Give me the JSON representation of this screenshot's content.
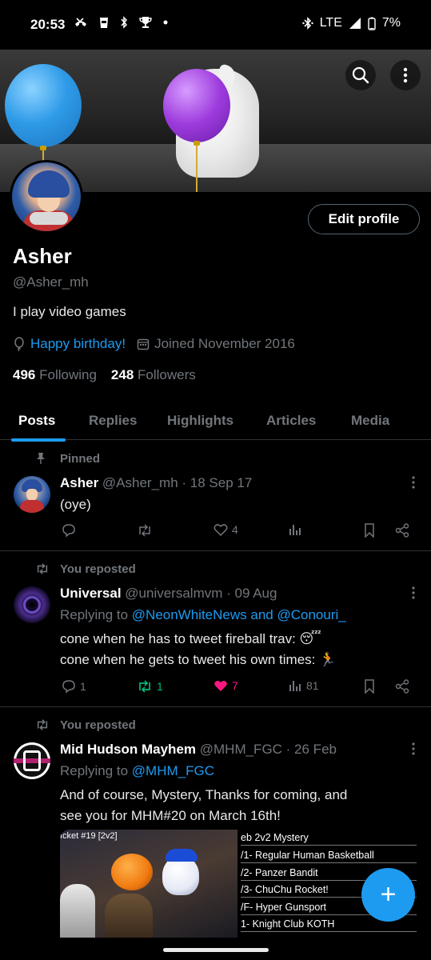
{
  "status_bar": {
    "time": "20:53",
    "left_icons": [
      "missed-call-icon",
      "cup-icon",
      "bluetooth-icon",
      "trophy-icon",
      "dot-icon"
    ],
    "network": "LTE",
    "battery": "7%"
  },
  "banner": {
    "search_icon": "search-icon",
    "more_icon": "more-vertical-icon"
  },
  "profile": {
    "edit_button": "Edit profile",
    "name": "Asher",
    "handle": "@Asher_mh",
    "bio": "I play video games",
    "birthday": "Happy birthday!",
    "joined": "Joined November 2016",
    "following_count": "496",
    "following_label": "Following",
    "followers_count": "248",
    "followers_label": "Followers"
  },
  "tabs": [
    {
      "label": "Posts",
      "active": true
    },
    {
      "label": "Replies",
      "active": false
    },
    {
      "label": "Highlights",
      "active": false
    },
    {
      "label": "Articles",
      "active": false
    },
    {
      "label": "Media",
      "active": false
    }
  ],
  "posts": [
    {
      "context": "Pinned",
      "name": "Asher",
      "handle_date": "@Asher_mh · 18 Sep 17",
      "text": "(oye)",
      "replies": "",
      "reposts": "",
      "likes": "4",
      "views": ""
    },
    {
      "context": "You reposted",
      "name": "Universal",
      "handle_date": "@universalmvm · 09 Aug",
      "reply_prefix": "Replying to ",
      "reply_targets": "@NeonWhiteNews and @Conouri_",
      "text_line1": "cone when he has to tweet fireball trav: 😴",
      "text_line2": "cone when he gets to tweet his own times: 🏃",
      "replies": "1",
      "reposts": "1",
      "likes": "7",
      "views": "81"
    },
    {
      "context": "You reposted",
      "name": "Mid Hudson Mayhem",
      "handle_date": "@MHM_FGC · 26 Feb",
      "reply_prefix": "Replying to ",
      "reply_targets": "@MHM_FGC",
      "text_line1": "And of course, Mystery, Thanks for coming, and",
      "text_line2": "see you for MHM#20 on March 16th!",
      "media_left_title": "ıcket #19 [2v2]",
      "media_right_rows": [
        "eb 2v2 Mystery",
        "/1- Regular Human Basketball",
        "/2- Panzer Bandit",
        "/3- ChuChu Rocket!",
        "/F- Hyper Gunsport",
        "1- Knight Club KOTH"
      ]
    }
  ],
  "fab": {
    "icon": "plus-icon",
    "label": "+"
  },
  "colors": {
    "accent": "#1d9bf0",
    "background": "#000000",
    "secondary_text": "#71767b",
    "repost_green": "#00ba7c",
    "like_pink": "#f91880"
  }
}
